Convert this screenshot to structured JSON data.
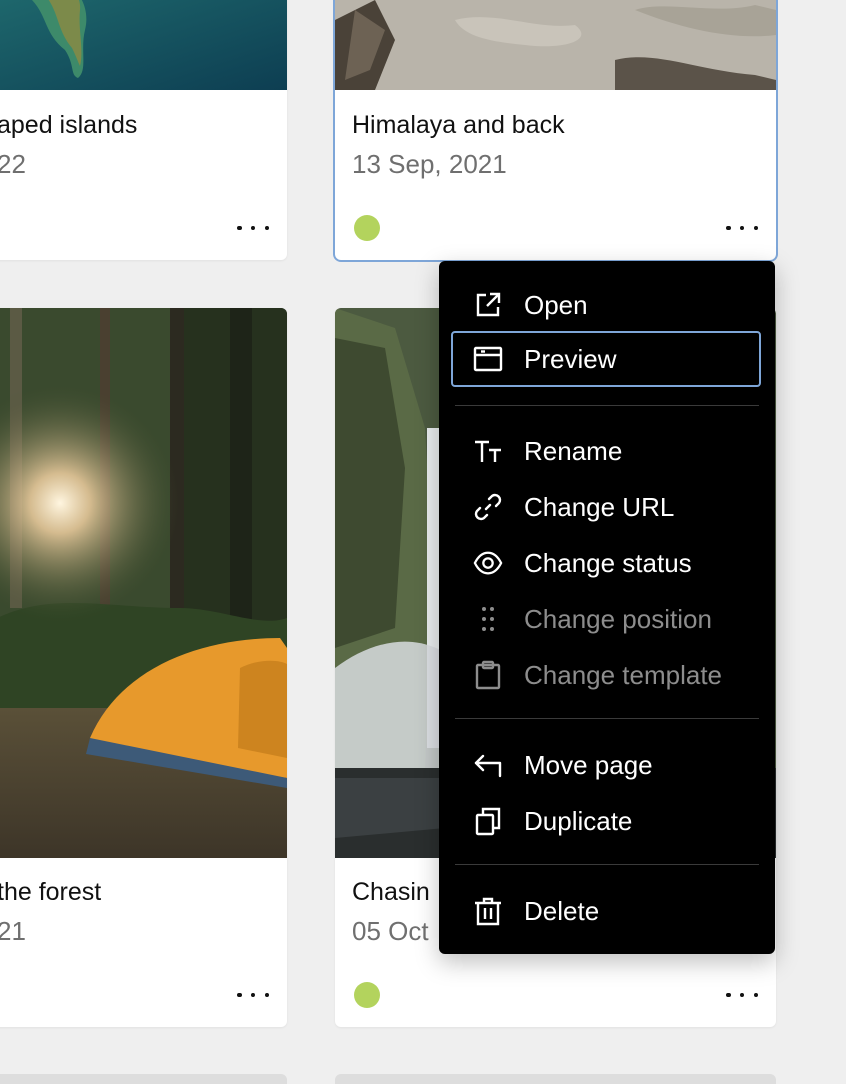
{
  "cards": [
    {
      "title": "aped islands",
      "date": "22",
      "has_status": false
    },
    {
      "title": "Himalaya and back",
      "date": "13 Sep, 2021",
      "has_status": true,
      "status_color": "#b3d35d"
    },
    {
      "title": "the forest",
      "date": "21",
      "has_status": false
    },
    {
      "title": "Chasin",
      "date": "05 Oct",
      "has_status": true,
      "status_color": "#b3d35d"
    }
  ],
  "menu": {
    "items": [
      {
        "label": "Open",
        "icon": "open-external-icon",
        "disabled": false
      },
      {
        "label": "Preview",
        "icon": "window-icon",
        "disabled": false,
        "focused": true
      },
      {
        "label": "Rename",
        "icon": "title-icon",
        "disabled": false
      },
      {
        "label": "Change URL",
        "icon": "link-icon",
        "disabled": false
      },
      {
        "label": "Change status",
        "icon": "eye-icon",
        "disabled": false
      },
      {
        "label": "Change position",
        "icon": "drag-handle-icon",
        "disabled": true
      },
      {
        "label": "Change template",
        "icon": "clipboard-icon",
        "disabled": true
      },
      {
        "label": "Move page",
        "icon": "arrow-back-icon",
        "disabled": false
      },
      {
        "label": "Duplicate",
        "icon": "copy-icon",
        "disabled": false
      },
      {
        "label": "Delete",
        "icon": "trash-icon",
        "disabled": false
      }
    ]
  },
  "colors": {
    "focus_ring": "#7ea6d8",
    "status_green": "#b3d35d",
    "menu_bg": "#000000",
    "page_bg": "#efefef"
  }
}
